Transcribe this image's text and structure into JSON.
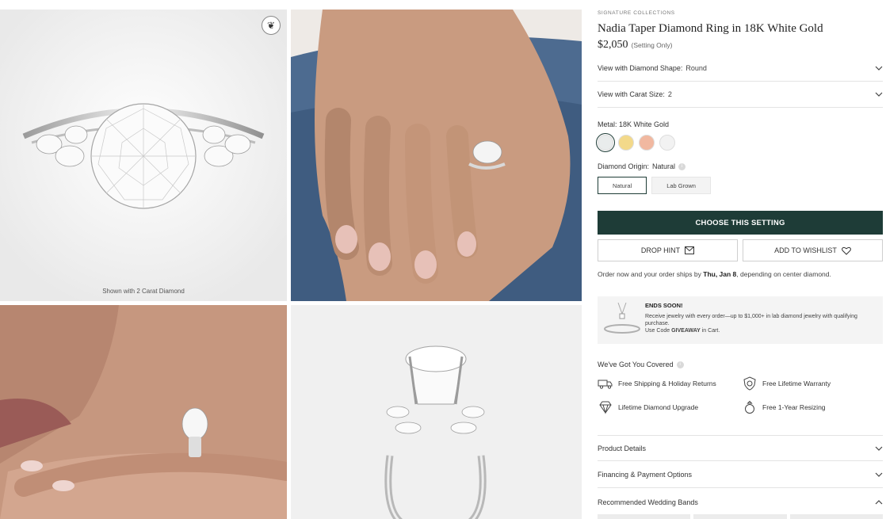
{
  "gallery": {
    "caption": "Shown with 2 Carat Diamond",
    "badge_icon": "hand-ring-icon"
  },
  "product": {
    "eyebrow": "SIGNATURE COLLECTIONS",
    "title": "Nadia Taper Diamond Ring in 18K White Gold",
    "price": "$2,050",
    "price_note": "(Setting Only)"
  },
  "options": {
    "shape_label": "View with Diamond Shape:",
    "shape_value": "Round",
    "carat_label": "View with Carat Size:",
    "carat_value": "2",
    "metal_label": "Metal:",
    "metal_value": "18K White Gold",
    "metal_swatches": [
      "#e9ecec",
      "#f3d98a",
      "#f1b8a0",
      "#f2f2f2"
    ],
    "origin_label": "Diamond Origin:",
    "origin_value": "Natural",
    "origin_buttons": [
      "Natural",
      "Lab Grown"
    ]
  },
  "actions": {
    "cta": "CHOOSE THIS SETTING",
    "drop_hint": "DROP HINT",
    "wishlist": "ADD TO WISHLIST",
    "ship_pre": "Order now and your order ships by",
    "ship_date": "Thu, Jan 8",
    "ship_post": ", depending on center diamond."
  },
  "promo": {
    "title": "ENDS SOON!",
    "body": "Receive jewelry with every order—up to $1,000+ in lab diamond jewelry with qualifying purchase.",
    "code_pre": "Use Code",
    "code": "GIVEAWAY",
    "code_post": "in Cart."
  },
  "covered": {
    "title": "We've Got You Covered",
    "perks": [
      "Free Shipping & Holiday Returns",
      "Free Lifetime Warranty",
      "Lifetime Diamond Upgrade",
      "Free 1-Year Resizing"
    ]
  },
  "accordions": [
    "Product Details",
    "Financing & Payment Options",
    "Recommended Wedding Bands"
  ],
  "colors": {
    "brand": "#1e3c37"
  }
}
